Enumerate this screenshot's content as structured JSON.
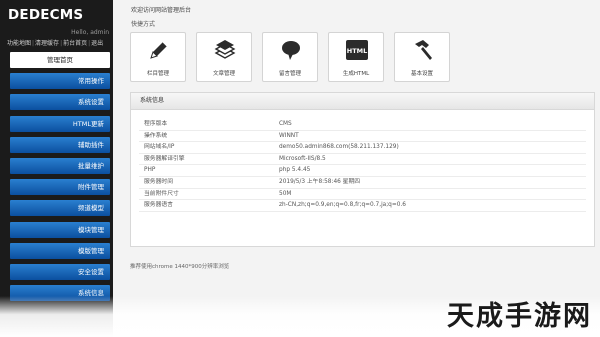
{
  "sidebar": {
    "logo": "DEDECMS",
    "hello": "Hello, admin",
    "top_links": [
      "功能地图",
      "清理缓存",
      "前台首页",
      "退出"
    ],
    "items": [
      {
        "label": "管理首页",
        "active": true
      },
      {
        "label": "常用操作"
      },
      {
        "label": "系统设置"
      },
      {
        "label": "HTML更新"
      },
      {
        "label": "辅助插件"
      },
      {
        "label": "批量维护"
      },
      {
        "label": "附件管理"
      },
      {
        "label": "频道模型"
      },
      {
        "label": "模块管理"
      },
      {
        "label": "模版管理"
      },
      {
        "label": "安全设置"
      },
      {
        "label": "系统信息"
      }
    ]
  },
  "main": {
    "welcome": "欢迎访问网站管理后台",
    "quick_title": "快捷方式",
    "quick_actions": [
      {
        "label": "栏目管理",
        "icon": "pencil-icon"
      },
      {
        "label": "文章管理",
        "icon": "document-stack-icon"
      },
      {
        "label": "留言管理",
        "icon": "speech-bubble-icon"
      },
      {
        "label": "生成HTML",
        "icon": "html-icon",
        "icon_text": "HTML"
      },
      {
        "label": "基本设置",
        "icon": "hammer-icon"
      }
    ],
    "system_info": {
      "title": "系统信息",
      "rows": [
        {
          "key": "程序版本",
          "value": "CMS"
        },
        {
          "key": "操作系统",
          "value": "WINNT"
        },
        {
          "key": "网站域名/IP",
          "value": "demo50.admin868.com(58.211.137.129)"
        },
        {
          "key": "服务器解译引擎",
          "value": "Microsoft-IIS/8.5"
        },
        {
          "key": "PHP",
          "value": "php 5.4.45"
        },
        {
          "key": "服务器时间",
          "value": "2019/5/3 上午8:58:46 星期四"
        },
        {
          "key": "当前附件尺寸",
          "value": "50M"
        },
        {
          "key": "服务器语言",
          "value": "zh-CN,zh;q=0.9,en;q=0.8,fr;q=0.7,ja;q=0.6"
        }
      ]
    },
    "footer_note": "推荐使用chrome 1440*900分辨率浏览"
  },
  "watermark": "天成手游网",
  "colors": {
    "sidebar_bg": "#1b1b1b",
    "nav_blue": "#1565c0",
    "panel_border": "#d8d8d8"
  }
}
